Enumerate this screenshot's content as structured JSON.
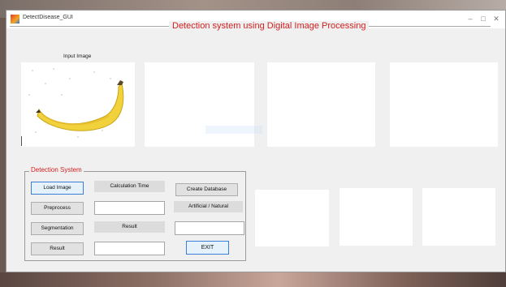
{
  "window": {
    "title": "DetectDisease_GUI",
    "minimize_label": "–",
    "maximize_label": "□",
    "close_label": "✕"
  },
  "heading": "Detection system using Digital Image Processing",
  "input_image_label": "Input Image",
  "group": {
    "title": "Detection System",
    "buttons": {
      "load_image": "Load Image",
      "preprocess": "Preprocess",
      "segmentation": "Segmentation",
      "result": "Result",
      "create_database": "Create Database",
      "exit": "EXIT"
    },
    "labels": {
      "calculation_time": "Calculation Time",
      "result": "Result",
      "artificial_natural": "Artificial /  Natural"
    },
    "fields": {
      "calculation_time_value": "",
      "result_value": "",
      "classification_value": "",
      "result_output": ""
    }
  },
  "colors": {
    "accent_red": "#d42020",
    "window_bg": "#f0f0f0",
    "button_bg": "#e1e1e1",
    "focus_blue": "#3c7fd6"
  }
}
